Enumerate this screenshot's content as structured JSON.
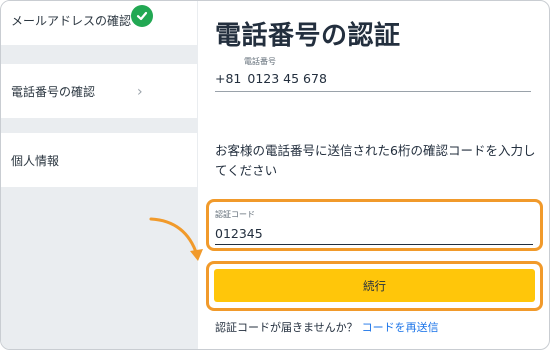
{
  "sidebar": {
    "items": [
      {
        "label": "メールアドレスの確認",
        "status": "completed"
      },
      {
        "label": "電話番号の確認",
        "status": "current"
      },
      {
        "label": "個人情報",
        "status": "pending"
      }
    ]
  },
  "main": {
    "title": "電話番号の認証",
    "phone": {
      "label": "電話番号",
      "country_code": "+81",
      "value": "0123 45 678"
    },
    "instruction": "お客様の電話番号に送信された6桁の確認コードを入力してください",
    "code": {
      "label": "認証コード",
      "value": "012345"
    },
    "continue_label": "続行",
    "resend_prompt": "認証コードが届きませんか？",
    "resend_link": "コードを再送信"
  },
  "colors": {
    "accent": "#ffc60a",
    "highlight": "#f19a2b",
    "success": "#22a853",
    "link": "#1a73e8"
  }
}
